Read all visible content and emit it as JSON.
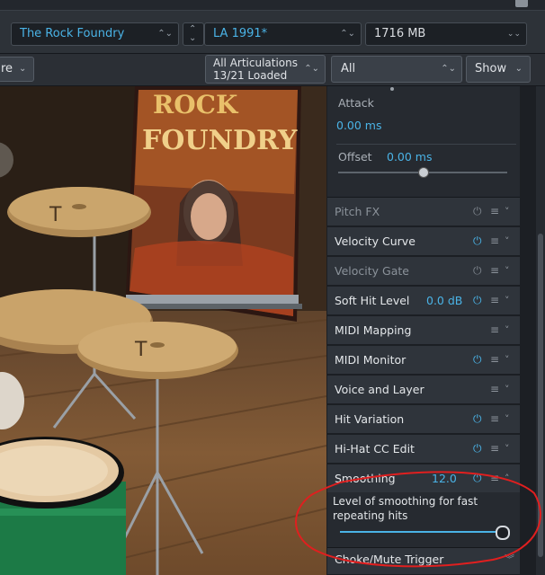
{
  "top": {
    "library": "The Rock Foundry",
    "preset": "LA 1991*",
    "memory": "1716 MB"
  },
  "bar2": {
    "left_partial": "re",
    "articulations_line1": "All Articulations",
    "articulations_line2": "13/21 Loaded",
    "filter": "All",
    "show": "Show"
  },
  "poster": {
    "title_top": "ROCK",
    "title_bottom": "FOUNDRY"
  },
  "envelope": {
    "attack_label": "Attack",
    "attack_value": "0.00 ms",
    "offset_label": "Offset",
    "offset_value": "0.00 ms",
    "offset_level": 0.5
  },
  "modules": [
    {
      "label": "Pitch FX",
      "value": "",
      "power": "off",
      "dim": true
    },
    {
      "label": "Velocity Curve",
      "value": "",
      "power": "on",
      "dim": false
    },
    {
      "label": "Velocity Gate",
      "value": "",
      "power": "off",
      "dim": true
    },
    {
      "label": "Soft Hit Level",
      "value": "0.0 dB",
      "power": "on",
      "dim": false
    },
    {
      "label": "MIDI Mapping",
      "value": "",
      "power": "none",
      "dim": false
    },
    {
      "label": "MIDI Monitor",
      "value": "",
      "power": "on",
      "dim": false
    },
    {
      "label": "Voice and Layer",
      "value": "",
      "power": "none",
      "dim": false
    },
    {
      "label": "Hit Variation",
      "value": "",
      "power": "on",
      "dim": false
    },
    {
      "label": "Hi-Hat CC Edit",
      "value": "",
      "power": "on",
      "dim": false
    },
    {
      "label": "Smoothing",
      "value": "12.0",
      "power": "on",
      "dim": false,
      "expanded": true
    }
  ],
  "smoothing": {
    "description": "Level of smoothing for fast repeating hits",
    "level": 0.97
  },
  "last_module": "Choke/Mute Trigger",
  "colors": {
    "accent": "#4ab3e6",
    "annotation": "#e01f1f"
  },
  "icons": {
    "power": "power-icon",
    "menu": "menu-lines-icon",
    "expand": "double-chevron-icon"
  }
}
